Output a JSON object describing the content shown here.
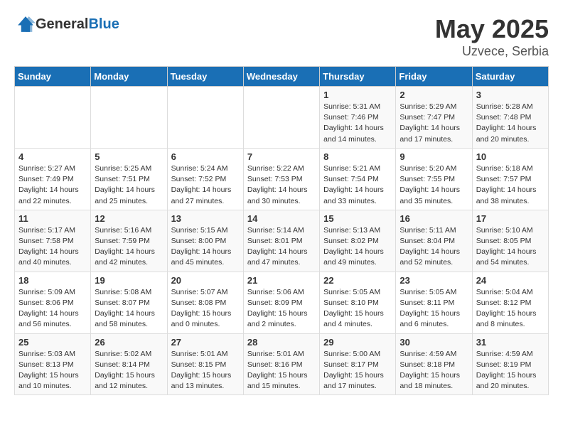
{
  "header": {
    "logo_general": "General",
    "logo_blue": "Blue",
    "title": "May 2025",
    "subtitle": "Uzvece, Serbia"
  },
  "weekdays": [
    "Sunday",
    "Monday",
    "Tuesday",
    "Wednesday",
    "Thursday",
    "Friday",
    "Saturday"
  ],
  "weeks": [
    [
      {
        "day": "",
        "info": ""
      },
      {
        "day": "",
        "info": ""
      },
      {
        "day": "",
        "info": ""
      },
      {
        "day": "",
        "info": ""
      },
      {
        "day": "1",
        "info": "Sunrise: 5:31 AM\nSunset: 7:46 PM\nDaylight: 14 hours\nand 14 minutes."
      },
      {
        "day": "2",
        "info": "Sunrise: 5:29 AM\nSunset: 7:47 PM\nDaylight: 14 hours\nand 17 minutes."
      },
      {
        "day": "3",
        "info": "Sunrise: 5:28 AM\nSunset: 7:48 PM\nDaylight: 14 hours\nand 20 minutes."
      }
    ],
    [
      {
        "day": "4",
        "info": "Sunrise: 5:27 AM\nSunset: 7:49 PM\nDaylight: 14 hours\nand 22 minutes."
      },
      {
        "day": "5",
        "info": "Sunrise: 5:25 AM\nSunset: 7:51 PM\nDaylight: 14 hours\nand 25 minutes."
      },
      {
        "day": "6",
        "info": "Sunrise: 5:24 AM\nSunset: 7:52 PM\nDaylight: 14 hours\nand 27 minutes."
      },
      {
        "day": "7",
        "info": "Sunrise: 5:22 AM\nSunset: 7:53 PM\nDaylight: 14 hours\nand 30 minutes."
      },
      {
        "day": "8",
        "info": "Sunrise: 5:21 AM\nSunset: 7:54 PM\nDaylight: 14 hours\nand 33 minutes."
      },
      {
        "day": "9",
        "info": "Sunrise: 5:20 AM\nSunset: 7:55 PM\nDaylight: 14 hours\nand 35 minutes."
      },
      {
        "day": "10",
        "info": "Sunrise: 5:18 AM\nSunset: 7:57 PM\nDaylight: 14 hours\nand 38 minutes."
      }
    ],
    [
      {
        "day": "11",
        "info": "Sunrise: 5:17 AM\nSunset: 7:58 PM\nDaylight: 14 hours\nand 40 minutes."
      },
      {
        "day": "12",
        "info": "Sunrise: 5:16 AM\nSunset: 7:59 PM\nDaylight: 14 hours\nand 42 minutes."
      },
      {
        "day": "13",
        "info": "Sunrise: 5:15 AM\nSunset: 8:00 PM\nDaylight: 14 hours\nand 45 minutes."
      },
      {
        "day": "14",
        "info": "Sunrise: 5:14 AM\nSunset: 8:01 PM\nDaylight: 14 hours\nand 47 minutes."
      },
      {
        "day": "15",
        "info": "Sunrise: 5:13 AM\nSunset: 8:02 PM\nDaylight: 14 hours\nand 49 minutes."
      },
      {
        "day": "16",
        "info": "Sunrise: 5:11 AM\nSunset: 8:04 PM\nDaylight: 14 hours\nand 52 minutes."
      },
      {
        "day": "17",
        "info": "Sunrise: 5:10 AM\nSunset: 8:05 PM\nDaylight: 14 hours\nand 54 minutes."
      }
    ],
    [
      {
        "day": "18",
        "info": "Sunrise: 5:09 AM\nSunset: 8:06 PM\nDaylight: 14 hours\nand 56 minutes."
      },
      {
        "day": "19",
        "info": "Sunrise: 5:08 AM\nSunset: 8:07 PM\nDaylight: 14 hours\nand 58 minutes."
      },
      {
        "day": "20",
        "info": "Sunrise: 5:07 AM\nSunset: 8:08 PM\nDaylight: 15 hours\nand 0 minutes."
      },
      {
        "day": "21",
        "info": "Sunrise: 5:06 AM\nSunset: 8:09 PM\nDaylight: 15 hours\nand 2 minutes."
      },
      {
        "day": "22",
        "info": "Sunrise: 5:05 AM\nSunset: 8:10 PM\nDaylight: 15 hours\nand 4 minutes."
      },
      {
        "day": "23",
        "info": "Sunrise: 5:05 AM\nSunset: 8:11 PM\nDaylight: 15 hours\nand 6 minutes."
      },
      {
        "day": "24",
        "info": "Sunrise: 5:04 AM\nSunset: 8:12 PM\nDaylight: 15 hours\nand 8 minutes."
      }
    ],
    [
      {
        "day": "25",
        "info": "Sunrise: 5:03 AM\nSunset: 8:13 PM\nDaylight: 15 hours\nand 10 minutes."
      },
      {
        "day": "26",
        "info": "Sunrise: 5:02 AM\nSunset: 8:14 PM\nDaylight: 15 hours\nand 12 minutes."
      },
      {
        "day": "27",
        "info": "Sunrise: 5:01 AM\nSunset: 8:15 PM\nDaylight: 15 hours\nand 13 minutes."
      },
      {
        "day": "28",
        "info": "Sunrise: 5:01 AM\nSunset: 8:16 PM\nDaylight: 15 hours\nand 15 minutes."
      },
      {
        "day": "29",
        "info": "Sunrise: 5:00 AM\nSunset: 8:17 PM\nDaylight: 15 hours\nand 17 minutes."
      },
      {
        "day": "30",
        "info": "Sunrise: 4:59 AM\nSunset: 8:18 PM\nDaylight: 15 hours\nand 18 minutes."
      },
      {
        "day": "31",
        "info": "Sunrise: 4:59 AM\nSunset: 8:19 PM\nDaylight: 15 hours\nand 20 minutes."
      }
    ]
  ]
}
